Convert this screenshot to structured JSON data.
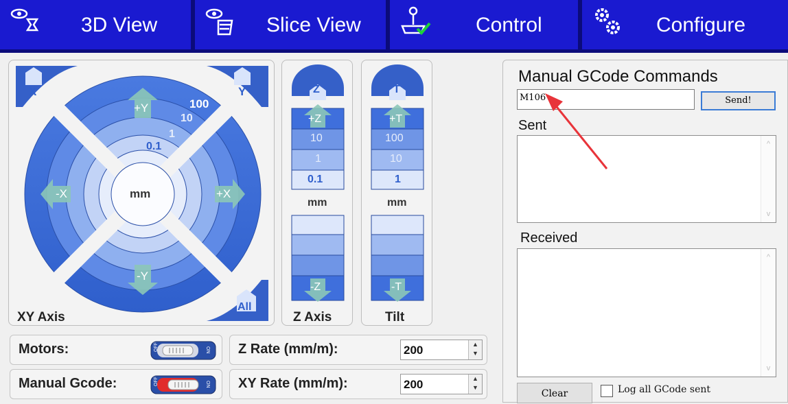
{
  "tabs": [
    {
      "label": "3D View",
      "icon": "eye-cup-icon"
    },
    {
      "label": "Slice View",
      "icon": "eye-layers-icon"
    },
    {
      "label": "Control",
      "icon": "joystick-check-icon"
    },
    {
      "label": "Configure",
      "icon": "gears-icon"
    }
  ],
  "xy": {
    "label": "XY Axis",
    "home_x": "X",
    "home_y": "Y",
    "home_all": "All",
    "plus_y": "+Y",
    "minus_y": "-Y",
    "plus_x": "+X",
    "minus_x": "-X",
    "step_100": "100",
    "step_10": "10",
    "step_1": "1",
    "step_01": "0.1",
    "unit": "mm"
  },
  "z": {
    "label": "Z Axis",
    "home": "Z",
    "plus": "+Z",
    "minus": "-Z",
    "steps": [
      "10",
      "1",
      "0.1"
    ],
    "unit": "mm"
  },
  "tilt": {
    "label": "Tilt",
    "home": "T",
    "plus": "+T",
    "minus": "-T",
    "steps": [
      "100",
      "10",
      "1"
    ],
    "unit": "mm"
  },
  "motors": {
    "label": "Motors:",
    "toggle_off": "OFF",
    "toggle_on": "ON",
    "state": "off"
  },
  "manual_gcode": {
    "label": "Manual Gcode:",
    "toggle_off": "OFF",
    "toggle_on": "ON",
    "state": "off"
  },
  "z_rate": {
    "label": "Z Rate (mm/m):",
    "value": "200"
  },
  "xy_rate": {
    "label": "XY Rate (mm/m):",
    "value": "200"
  },
  "gcode": {
    "title": "Manual GCode Commands",
    "command": "M106",
    "send": "Send!",
    "sent_label": "Sent",
    "received_label": "Received",
    "clear": "Clear",
    "log_label": "Log all GCode sent",
    "log_checked": false
  },
  "colors": {
    "tab_bg": "#1a1ad0",
    "tab_bar": "#0b0b7a",
    "ring_dark": "#3f6fdc",
    "annotation_arrow": "#e8343a"
  }
}
